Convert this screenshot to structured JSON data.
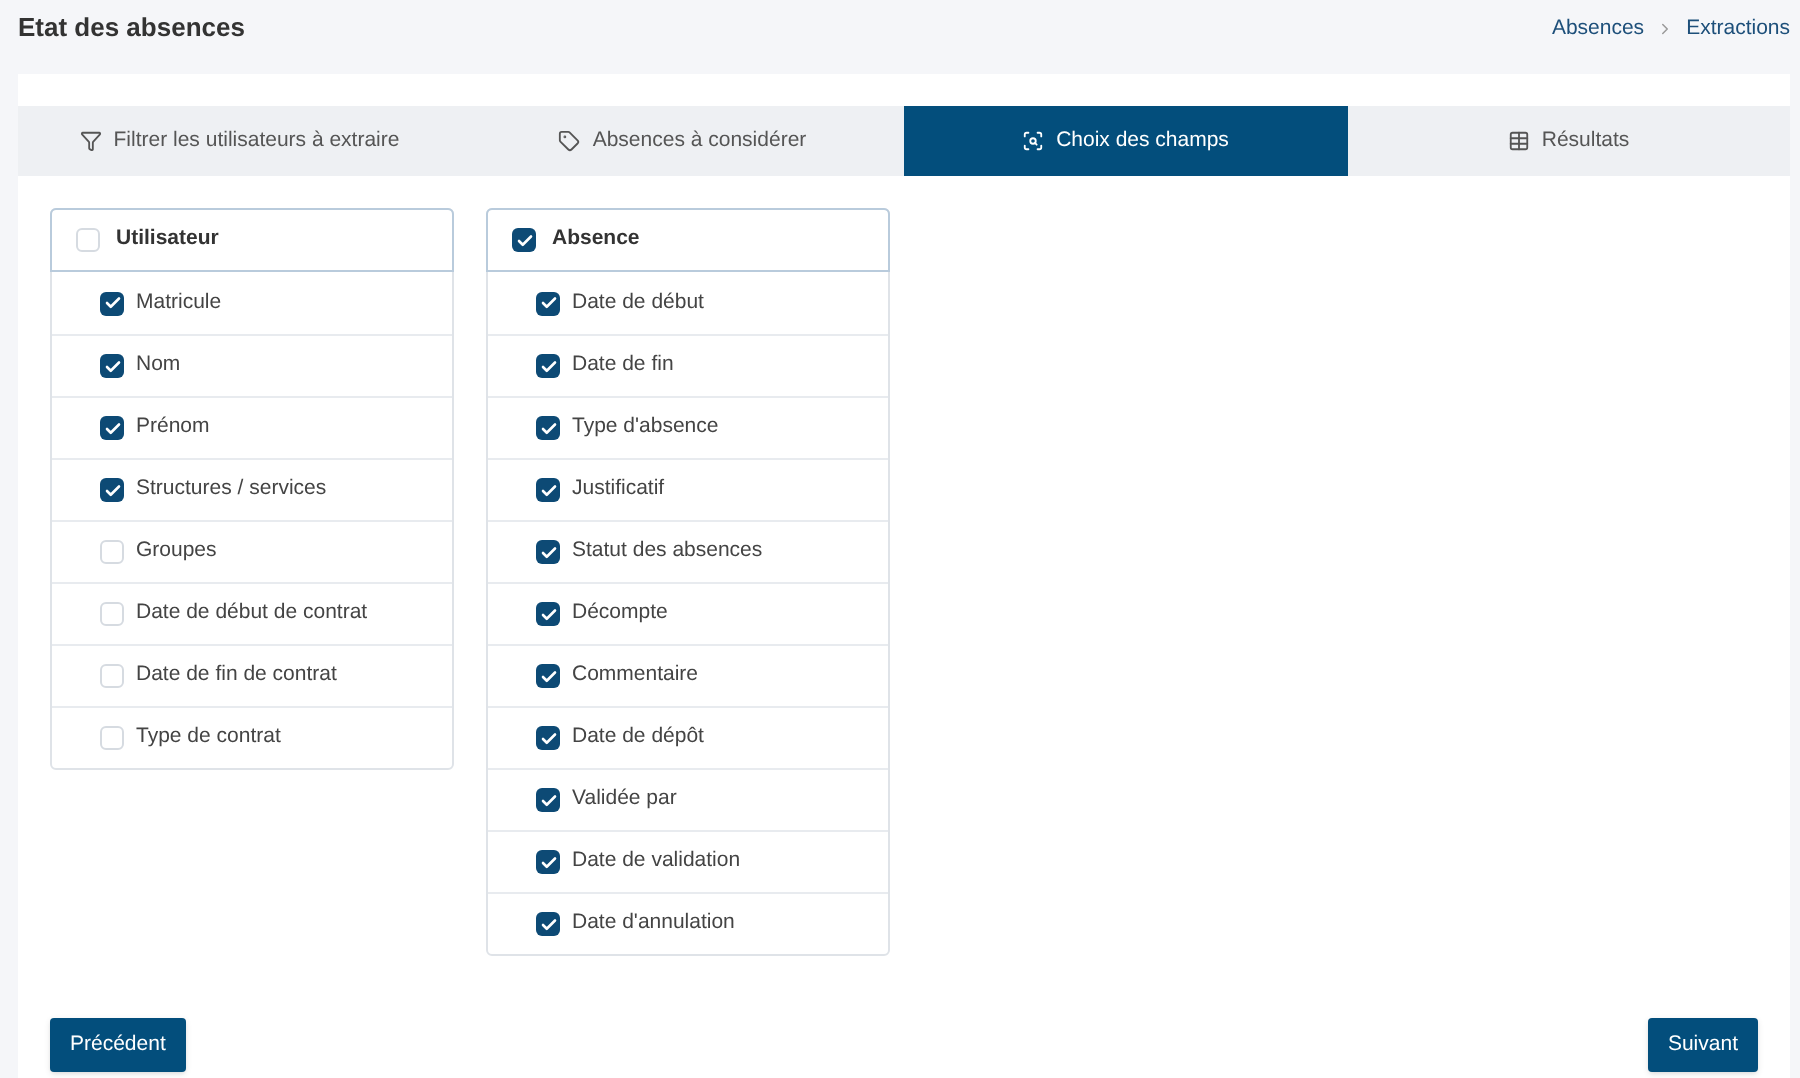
{
  "page_title": "Etat des absences",
  "breadcrumb": [
    "Absences",
    "Extractions"
  ],
  "tabs": [
    {
      "label": "Filtrer les utilisateurs à extraire",
      "selected": false
    },
    {
      "label": "Absences à considérer",
      "selected": false
    },
    {
      "label": "Choix des champs",
      "selected": true
    },
    {
      "label": "Résultats",
      "selected": false
    }
  ],
  "groups": [
    {
      "title": "Utilisateur",
      "checked": false,
      "fields": [
        {
          "label": "Matricule",
          "checked": true
        },
        {
          "label": "Nom",
          "checked": true
        },
        {
          "label": "Prénom",
          "checked": true
        },
        {
          "label": "Structures / services",
          "checked": true
        },
        {
          "label": "Groupes",
          "checked": false
        },
        {
          "label": "Date de début de contrat",
          "checked": false
        },
        {
          "label": "Date de fin de contrat",
          "checked": false
        },
        {
          "label": "Type de contrat",
          "checked": false
        }
      ]
    },
    {
      "title": "Absence",
      "checked": true,
      "fields": [
        {
          "label": "Date de début",
          "checked": true
        },
        {
          "label": "Date de fin",
          "checked": true
        },
        {
          "label": "Type d'absence",
          "checked": true
        },
        {
          "label": "Justificatif",
          "checked": true
        },
        {
          "label": "Statut des absences",
          "checked": true
        },
        {
          "label": "Décompte",
          "checked": true
        },
        {
          "label": "Commentaire",
          "checked": true
        },
        {
          "label": "Date de dépôt",
          "checked": true
        },
        {
          "label": "Validée par",
          "checked": true
        },
        {
          "label": "Date de validation",
          "checked": true
        },
        {
          "label": "Date d'annulation",
          "checked": true
        }
      ]
    }
  ],
  "buttons": {
    "previous": "Précédent",
    "next": "Suivant"
  }
}
